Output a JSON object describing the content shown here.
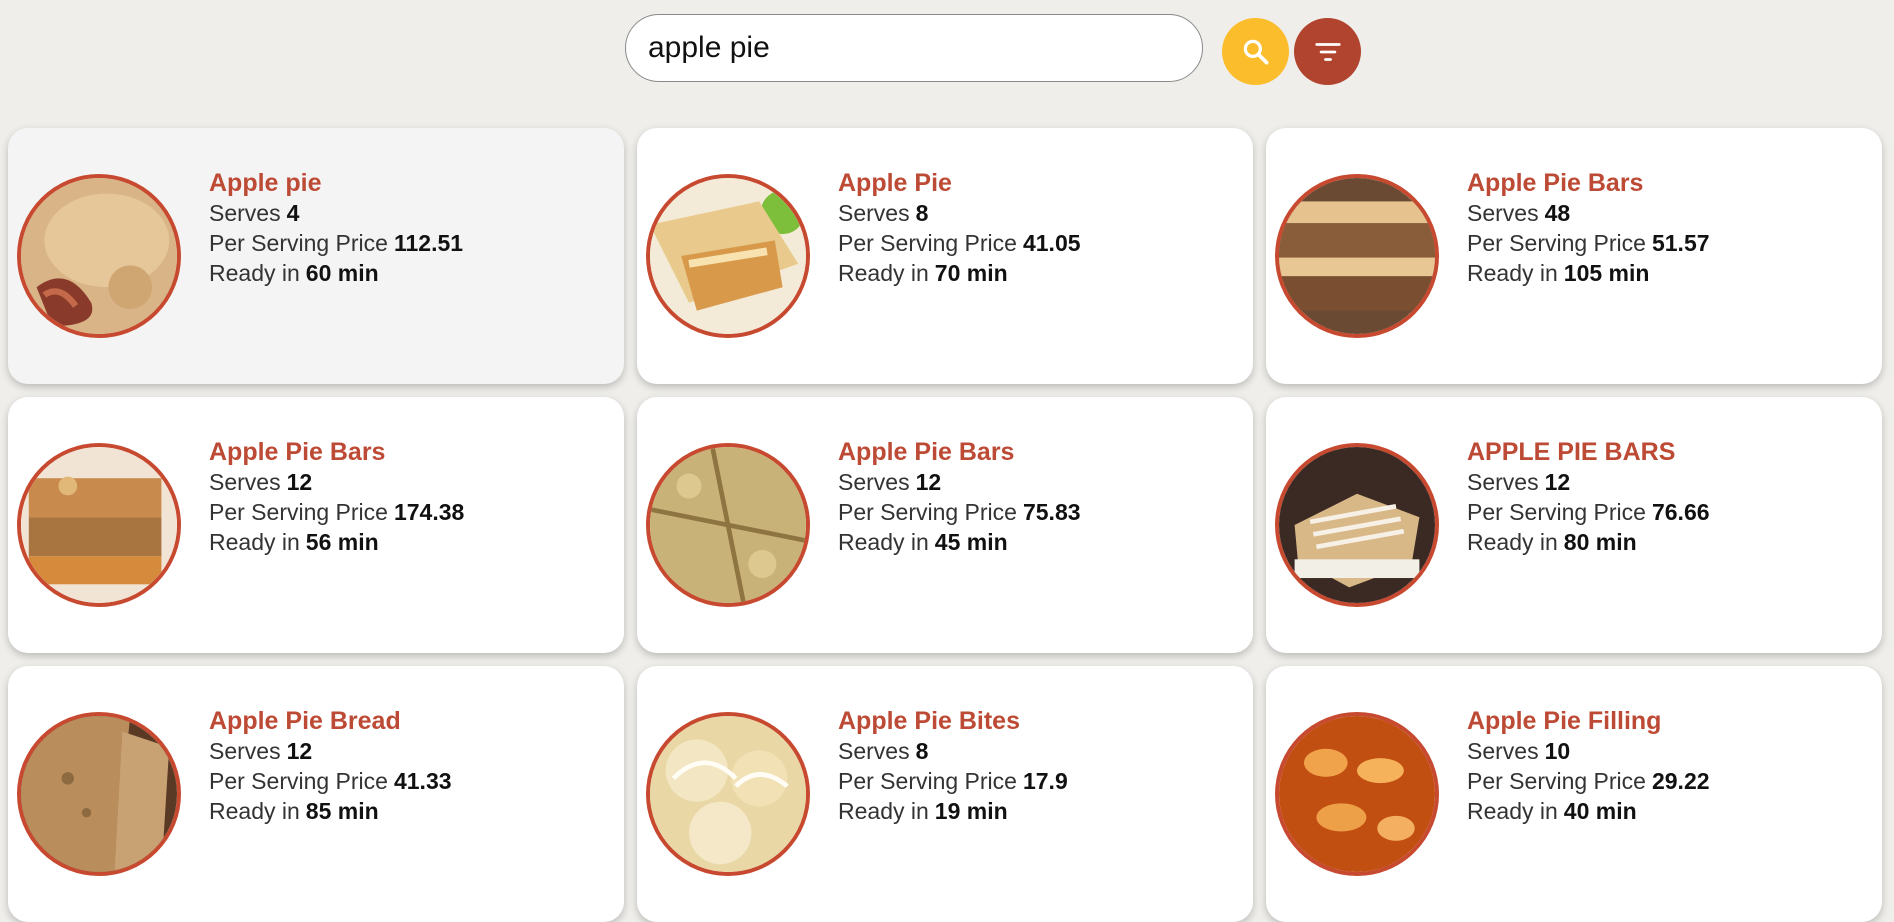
{
  "search": {
    "value": "apple pie",
    "placeholder": ""
  },
  "buttons": {
    "search_icon": "search-icon",
    "filter_icon": "filter-icon"
  },
  "colors": {
    "title": "#bd4a34",
    "search_button": "#fbbd2b",
    "filter_button": "#b1442e",
    "thumb_border": "#c7492f",
    "background": "#efeeea"
  },
  "labels": {
    "serves": "Serves",
    "price": "Per Serving Price",
    "ready": "Ready in"
  },
  "recipes": [
    {
      "title": "Apple pie",
      "serves": "4",
      "price": "112.51",
      "ready": "60 min"
    },
    {
      "title": "Apple Pie",
      "serves": "8",
      "price": "41.05",
      "ready": "70 min"
    },
    {
      "title": "Apple Pie Bars",
      "serves": "48",
      "price": "51.57",
      "ready": "105 min"
    },
    {
      "title": "Apple Pie Bars",
      "serves": "12",
      "price": "174.38",
      "ready": "56 min"
    },
    {
      "title": "Apple Pie Bars",
      "serves": "12",
      "price": "75.83",
      "ready": "45 min"
    },
    {
      "title": "APPLE PIE BARS",
      "serves": "12",
      "price": "76.66",
      "ready": "80 min"
    },
    {
      "title": "Apple Pie Bread",
      "serves": "12",
      "price": "41.33",
      "ready": "85 min"
    },
    {
      "title": "Apple Pie Bites",
      "serves": "8",
      "price": "17.9",
      "ready": "19 min"
    },
    {
      "title": "Apple Pie Filling",
      "serves": "10",
      "price": "29.22",
      "ready": "40 min"
    }
  ]
}
